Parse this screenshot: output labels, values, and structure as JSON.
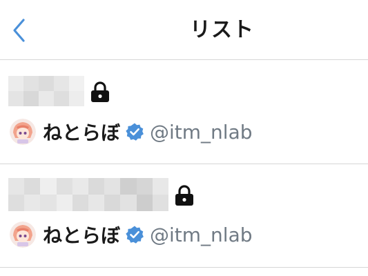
{
  "header": {
    "title": "リスト",
    "back_icon": "chevron-left-icon"
  },
  "colors": {
    "accent": "#4a90d9",
    "verified": "#4a90d9",
    "text": "#1a1a1a",
    "secondary_text": "#707a84",
    "divider": "#d6d6d6"
  },
  "lists": [
    {
      "name_state": "obscured",
      "private": true,
      "owner": {
        "display_name": "ねとらぼ",
        "verified": true,
        "handle": "@itm_nlab"
      }
    },
    {
      "name_state": "obscured",
      "private": true,
      "owner": {
        "display_name": "ねとらぼ",
        "verified": true,
        "handle": "@itm_nlab"
      }
    }
  ]
}
